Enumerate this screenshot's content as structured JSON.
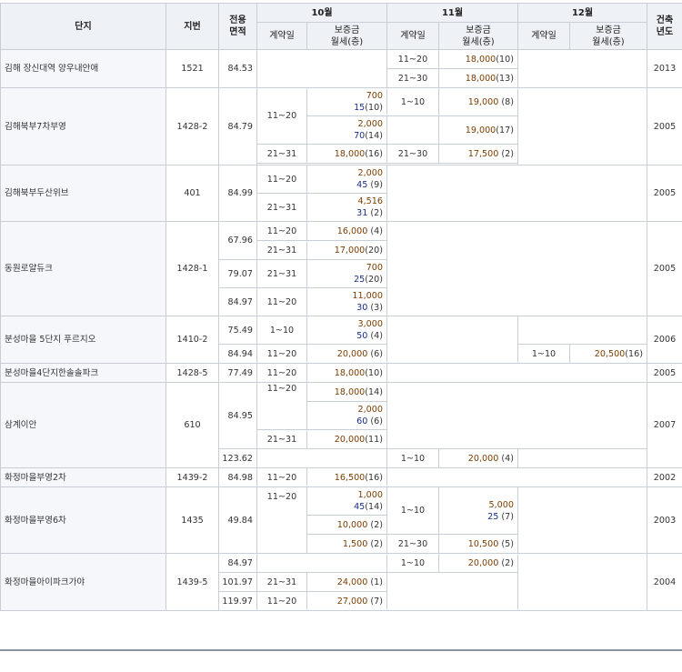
{
  "headers": {
    "complex": "단지",
    "lot": "지번",
    "area": "전용\n면적",
    "months": [
      "10월",
      "11월",
      "12월"
    ],
    "contract_day": "계약일",
    "deposit": "보증금\n월세(층)",
    "built_year": "건축\n년도"
  },
  "rows": [
    {
      "complex": "김해 장신대역 양우내안애",
      "lot": "1521",
      "area": "84.53",
      "m11": [
        [
          "11~20",
          "18,000",
          "(10)"
        ],
        [
          "21~30",
          "18,000",
          "(13)"
        ]
      ],
      "year": "2013"
    },
    {
      "complex": "김해북부7차부영",
      "lot": "1428-2",
      "area": "84.79",
      "m10": [
        [
          "11~20",
          "700",
          "15",
          "(10)"
        ],
        [
          "",
          "2,000",
          "70",
          "(14)"
        ],
        [
          "21~31",
          "18,000",
          "",
          "(16)"
        ]
      ],
      "m11": [
        [
          "1~10",
          "19,000",
          "",
          "(8)"
        ],
        [
          "",
          "19,000",
          "",
          "(17)"
        ],
        [
          "21~30",
          "17,500",
          "",
          "(2)"
        ]
      ],
      "year": "2005"
    },
    {
      "complex": "김해북부두산위브",
      "lot": "401",
      "area": "84.99",
      "m10": [
        [
          "11~20",
          "2,000",
          "45",
          "(9)"
        ],
        [
          "21~31",
          "4,516",
          "31",
          "(2)"
        ]
      ],
      "year": "2005"
    },
    {
      "complex": "동원로얄듀크",
      "lot": "1428-1",
      "areas": [
        "67.96",
        "79.07",
        "84.97"
      ],
      "m10": [
        [
          "11~20",
          "16,000",
          "",
          "(4)"
        ],
        [
          "21~31",
          "17,000",
          "",
          "(20)"
        ],
        [
          "21~31",
          "700",
          "25",
          "(20)"
        ],
        [
          "11~20",
          "11,000",
          "30",
          "(3)"
        ]
      ],
      "year": "2005"
    },
    {
      "complex": "분성마을 5단지 푸르지오",
      "lot": "1410-2",
      "areas": [
        "75.49",
        "84.94"
      ],
      "m10": [
        [
          "1~10",
          "3,000",
          "50",
          "(4)"
        ],
        [
          "11~20",
          "20,000",
          "",
          "(6)"
        ]
      ],
      "m12": [
        [
          "1~10",
          "20,500",
          "",
          "(16)"
        ]
      ],
      "year": "2006"
    },
    {
      "complex": "분성마을4단지한솔솔파크",
      "lot": "1428-5",
      "area": "77.49",
      "m10": [
        [
          "11~20",
          "18,000",
          "",
          "(10)"
        ]
      ],
      "year": "2005"
    },
    {
      "complex": "삼계이안",
      "lot": "610",
      "areas": [
        "84.95",
        "123.62"
      ],
      "m10": [
        [
          "11~20",
          "18,000",
          "",
          "(14)"
        ],
        [
          "",
          "2,000",
          "60",
          "(6)"
        ],
        [
          "21~31",
          "20,000",
          "",
          "(11)"
        ]
      ],
      "m11": [
        [
          "1~10",
          "20,000",
          "",
          "(4)"
        ]
      ],
      "year": "2007"
    },
    {
      "complex": "화정마을부영2차",
      "lot": "1439-2",
      "area": "84.98",
      "m10": [
        [
          "11~20",
          "16,500",
          "",
          "(16)"
        ]
      ],
      "year": "2002"
    },
    {
      "complex": "화정마을부영6차",
      "lot": "1435",
      "area": "49.84",
      "m10": [
        [
          "11~20",
          "1,000",
          "45",
          "(14)"
        ],
        [
          "",
          "10,000",
          "",
          "(2)"
        ],
        [
          "",
          "1,500",
          "",
          "(2)"
        ]
      ],
      "m11": [
        [
          "1~10",
          "5,000",
          "25",
          "(7)"
        ],
        [
          "21~30",
          "10,500",
          "",
          "(5)"
        ]
      ],
      "year": "2003"
    },
    {
      "complex": "화정마을아이파크가야",
      "lot": "1439-5",
      "areas": [
        "84.97",
        "101.97",
        "119.97"
      ],
      "m10": [
        [
          "21~31",
          "24,000",
          "",
          "(1)"
        ],
        [
          "11~20",
          "27,000",
          "",
          "(7)"
        ]
      ],
      "m11": [
        [
          "1~10",
          "20,000",
          "",
          "(2)"
        ]
      ],
      "year": "2004"
    }
  ],
  "colors": {
    "header_bg": "#eef2f6",
    "border": "#c9ced6",
    "deposit": "#7a3d00",
    "monthly": "#1a2f8a"
  }
}
